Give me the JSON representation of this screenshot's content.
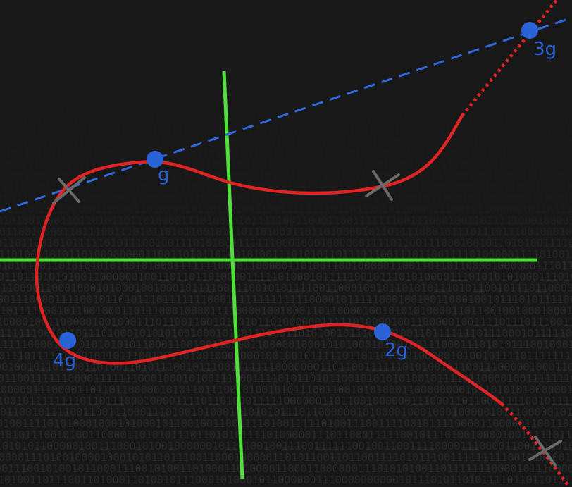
{
  "points": [
    {
      "id": "g",
      "label": "g"
    },
    {
      "id": "2g",
      "label": "2g"
    },
    {
      "id": "3g",
      "label": "3g"
    },
    {
      "id": "4g",
      "label": "4g"
    }
  ],
  "colors": {
    "background": "#181818",
    "binary_text": "#2a2a2a",
    "axes": "#4fe03a",
    "curve": "#e02424",
    "tangent_line": "#2f68e0",
    "points": "#2a62d8",
    "cross_marks": "#6a6a6a"
  },
  "background_pattern": "binary digits (0/1) texture"
}
